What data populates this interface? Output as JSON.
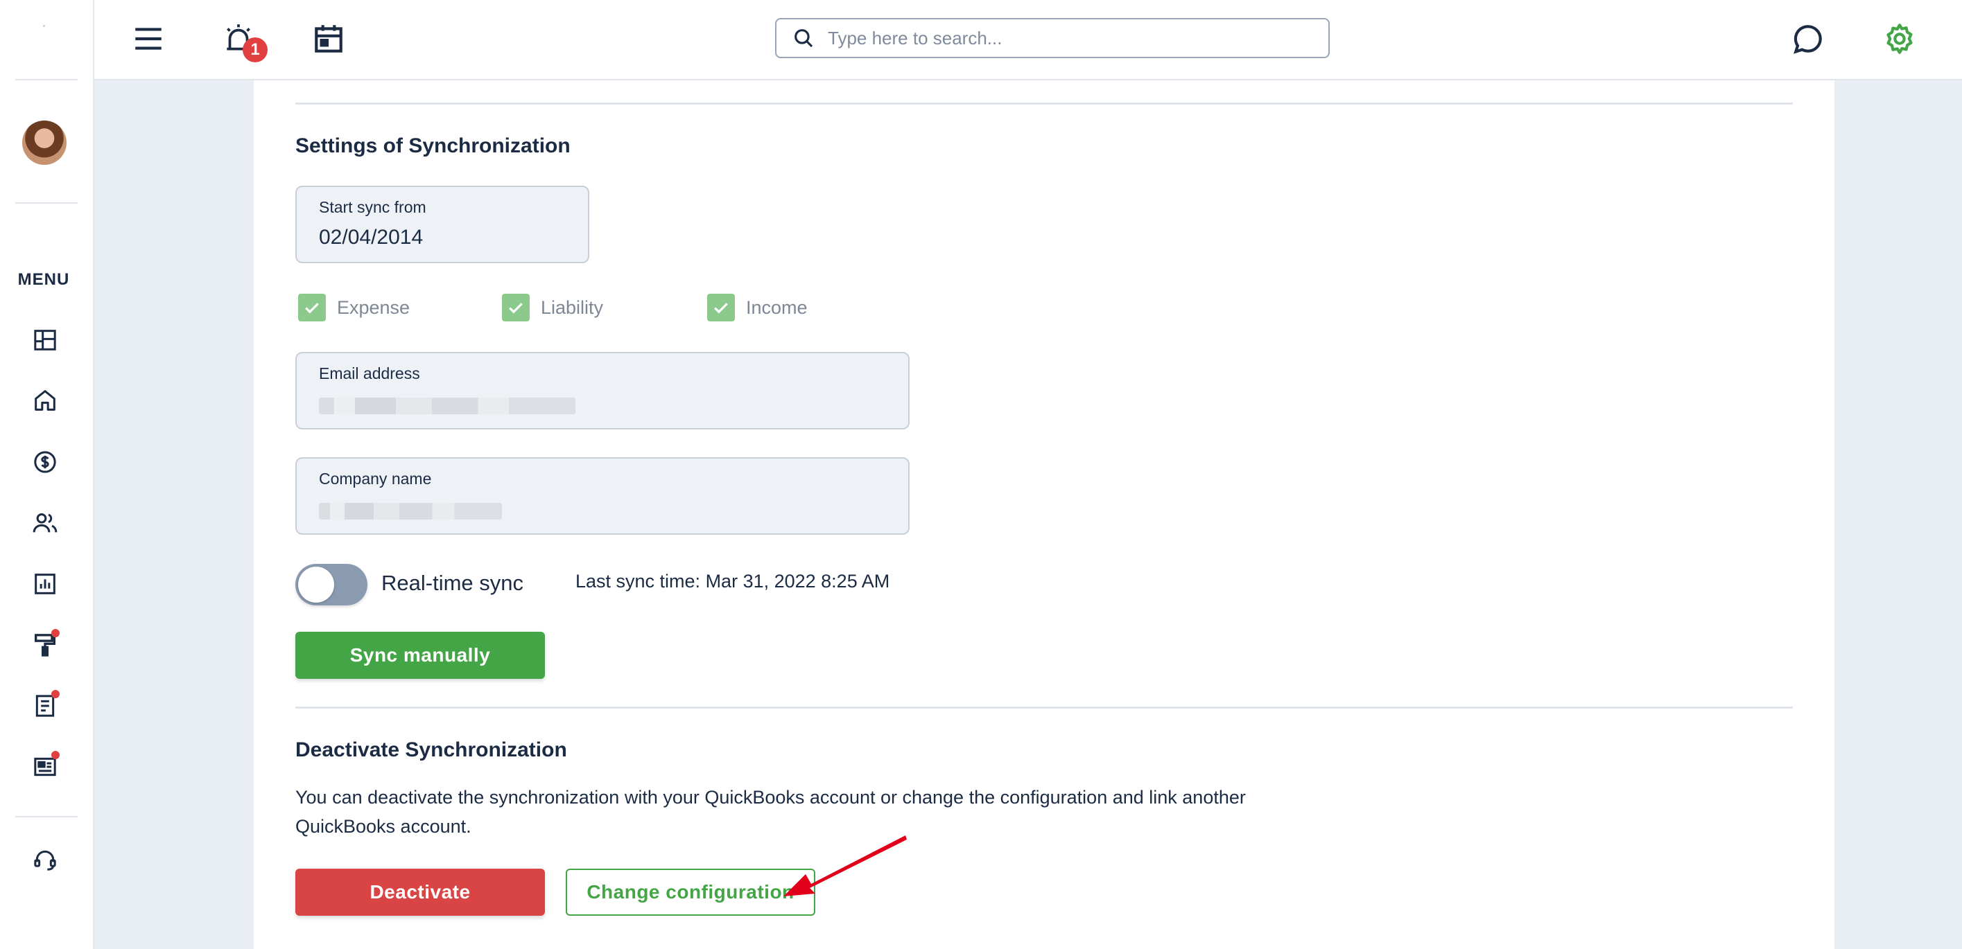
{
  "sidebar": {
    "menu_label": "MENU",
    "items": [
      {
        "icon": "dashboard-icon"
      },
      {
        "icon": "home-icon"
      },
      {
        "icon": "dollar-icon"
      },
      {
        "icon": "users-icon"
      },
      {
        "icon": "chart-icon"
      },
      {
        "icon": "paint-roller-icon",
        "notification": true
      },
      {
        "icon": "document-icon",
        "notification": true
      },
      {
        "icon": "newspaper-icon",
        "notification": true
      }
    ],
    "support_icon": "headset-icon"
  },
  "topbar": {
    "notification_count": "1",
    "search_placeholder": "Type here to search..."
  },
  "sync_settings": {
    "title": "Settings of Synchronization",
    "start_sync_label": "Start sync from",
    "start_sync_value": "02/04/2014",
    "checkboxes": [
      {
        "label": "Expense",
        "checked": true
      },
      {
        "label": "Liability",
        "checked": true
      },
      {
        "label": "Income",
        "checked": true
      }
    ],
    "email_label": "Email address",
    "company_label": "Company name",
    "realtime_label": "Real-time sync",
    "realtime_on": false,
    "last_sync": "Last sync time: Mar 31, 2022 8:25 AM",
    "sync_button": "Sync manually"
  },
  "deactivate": {
    "title": "Deactivate Synchronization",
    "description": "You can deactivate the synchronization with your QuickBooks account or change the configuration and link another QuickBooks account.",
    "deactivate_button": "Deactivate",
    "change_button": "Change configuration"
  },
  "colors": {
    "accent_green": "#44a546",
    "danger_red": "#d94444",
    "annotation_arrow": "#e0001b"
  }
}
